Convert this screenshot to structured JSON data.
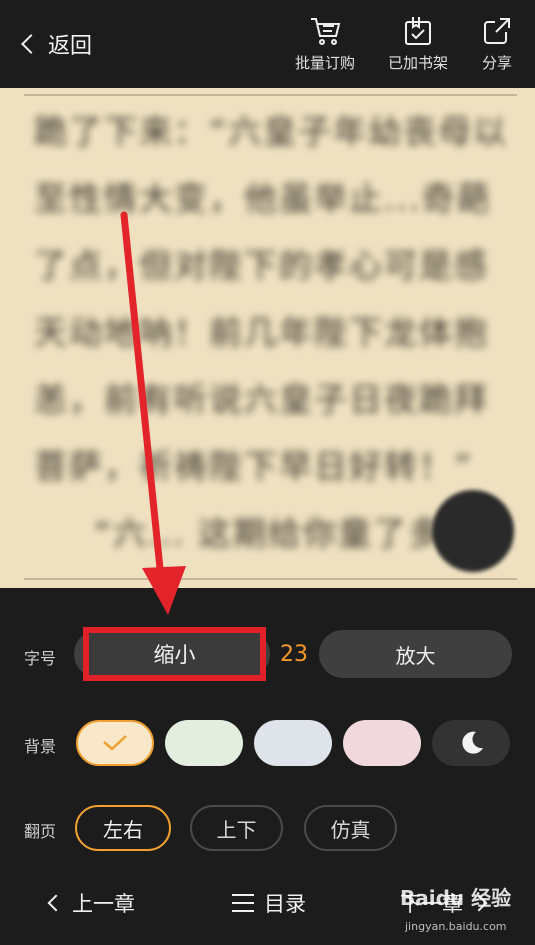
{
  "header": {
    "back_label": "返回",
    "tools": {
      "batch_order": "批量订购",
      "added_to_shelf": "已加书架",
      "share": "分享"
    }
  },
  "reader": {
    "lines": [
      "跪了下来：“六皇子年幼丧母以",
      "至性情大变，他虽举止...奇葩",
      "了点，但对陛下的孝心可是感",
      "天动地呐！前几年陛下龙体抱",
      "恙，前有听说六皇子日夜跪拜",
      "菩萨，祈祷陛下早日好转！”",
      "“六... 这期给你童了多少银"
    ]
  },
  "settings": {
    "font_size": {
      "label": "字号",
      "decrease_label": "缩小",
      "value": "23",
      "increase_label": "放大"
    },
    "background": {
      "label": "背景",
      "options": [
        "#f8e7c8",
        "#e3eedf",
        "#dfe3ea",
        "#f0d8dd",
        "#333333"
      ],
      "selected_index": 0
    },
    "page_turn": {
      "label": "翻页",
      "options": [
        "左右",
        "上下",
        "仿真"
      ],
      "selected": "左右"
    }
  },
  "bottom_nav": {
    "prev_chapter": "上一章",
    "catalog": "目录",
    "next_chapter": "下一章"
  },
  "watermark": {
    "brand": "Baidu 经验",
    "url": "jingyan.baidu.com"
  },
  "colors": {
    "accent": "#f59a2a",
    "annotation_red": "#e0212a"
  }
}
